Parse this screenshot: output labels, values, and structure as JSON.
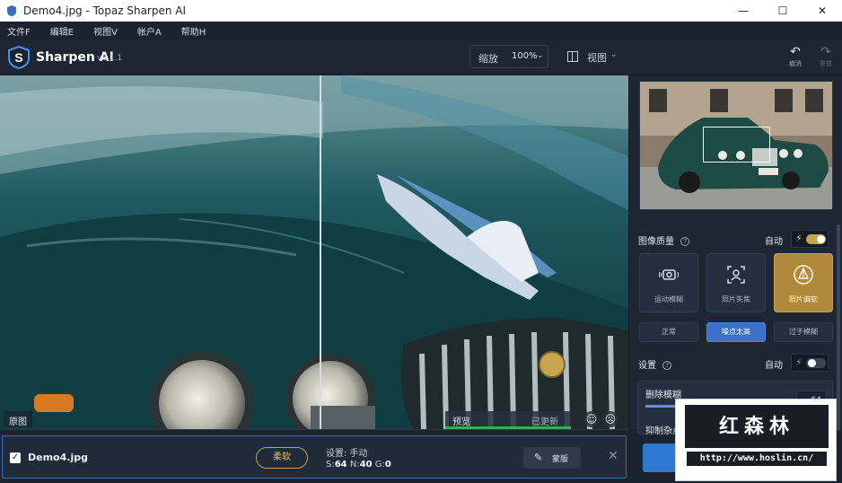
{
  "window": {
    "title": "Demo4.jpg - Topaz Sharpen AI",
    "minimize": "—",
    "maximize": "☐",
    "close": "✕"
  },
  "menu": [
    "文件F",
    "编辑E",
    "视图V",
    "帐户A",
    "帮助H"
  ],
  "header": {
    "brand": "Sharpen AI",
    "version": "v3.1.1",
    "zoom_label": "缩放",
    "zoom_value": "100%",
    "view_label": "视图",
    "undo_label": "撤消",
    "redo_label": "重做"
  },
  "canvas": {
    "original_label": "原图",
    "preview_label": "预览",
    "updated_label": "已更新"
  },
  "panel": {
    "image_quality_title": "图像质量",
    "auto_label": "自动",
    "auto_quality_on": true,
    "modes": [
      {
        "label": "运动模糊",
        "icon": "motion-blur-icon",
        "active": false
      },
      {
        "label": "照片失焦",
        "icon": "out-of-focus-icon",
        "active": false
      },
      {
        "label": "照片偏软",
        "icon": "too-soft-icon",
        "active": true
      }
    ],
    "noise_levels": [
      {
        "label": "正常",
        "active": false
      },
      {
        "label": "噪点太高",
        "active": true
      },
      {
        "label": "过于模糊",
        "active": false
      }
    ],
    "settings_title": "设置",
    "settings_auto_label": "自动",
    "settings_auto_on": false,
    "remove_blur_label": "删除模糊",
    "remove_blur_value": "64",
    "remove_blur_fraction": 0.64,
    "suppress_noise_label": "抑制杂点"
  },
  "file_row": {
    "filename": "Demo4.jpg",
    "checked": true,
    "mode_pill": "柔软",
    "settings_text": "设置: 手动",
    "s_label": "S:",
    "s_value": "64",
    "n_label": "N:",
    "n_value": "40",
    "g_label": "G:",
    "g_value": "0",
    "mask_label": "蒙版"
  },
  "watermark": {
    "title": "红森林",
    "url": "http://www.hoslin.cn/"
  },
  "colors": {
    "accent_blue": "#3b71c7",
    "active_gold": "#b08a3a",
    "preview_progress": "#2fb359"
  }
}
